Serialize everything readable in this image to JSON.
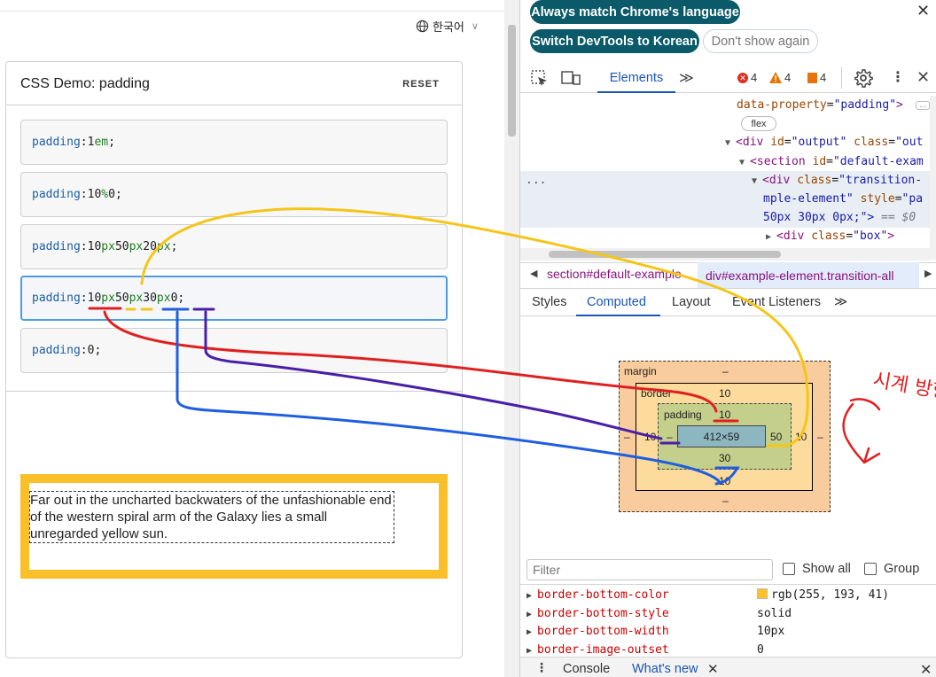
{
  "page": {
    "language": "한국어",
    "demo_title": "CSS Demo: padding",
    "reset_label": "RESET",
    "choices": [
      {
        "prop": "padding",
        "tokens": [
          {
            "n": "1",
            "u": "em"
          }
        ],
        "end": ";"
      },
      {
        "prop": "padding",
        "tokens": [
          {
            "n": "10",
            "u": "%"
          },
          {
            "n": "0",
            "u": ""
          }
        ],
        "end": ";"
      },
      {
        "prop": "padding",
        "tokens": [
          {
            "n": "10",
            "u": "px"
          },
          {
            "n": "50",
            "u": "px"
          },
          {
            "n": "20",
            "u": "px"
          }
        ],
        "end": ";"
      },
      {
        "prop": "padding",
        "tokens": [
          {
            "n": "10",
            "u": "px"
          },
          {
            "n": "50",
            "u": "px"
          },
          {
            "n": "30",
            "u": "px"
          },
          {
            "n": "0",
            "u": ""
          }
        ],
        "end": ";"
      },
      {
        "prop": "padding",
        "tokens": [
          {
            "n": "0",
            "u": ""
          }
        ],
        "end": ";"
      }
    ],
    "selected_choice": 3,
    "example_text": "Far out in the uncharted backwaters of the unfashionable end of the western spiral arm of the Galaxy lies a small unregarded yellow sun."
  },
  "devtools": {
    "banner": {
      "match_language": "Always match Chrome's language",
      "switch_language": "Switch DevTools to Korean",
      "dont_show": "Don't show again"
    },
    "tabs": {
      "elements": "Elements",
      "more": "≫"
    },
    "counts": {
      "errors": "4",
      "warnings": "4",
      "issues": "4"
    },
    "dom": {
      "line1": {
        "attr": "data-property",
        "val": "\"padding\"",
        "tail": ">"
      },
      "flex_badge": "flex",
      "line2": {
        "tag": "<div",
        "a1": "id",
        "v1": "\"output\"",
        "a2": "class",
        "v2": "\"out"
      },
      "line3": {
        "tag": "<section",
        "a1": "id",
        "v1": "\"default-exam"
      },
      "line4": {
        "tag": "<div",
        "a1": "class",
        "v1": "\"transition-"
      },
      "line5": {
        "a1": "mple-element\"",
        "a2": "style",
        "v2": "\"pa"
      },
      "line6": {
        "v": "50px 30px 0px;\">",
        "eq": " == $0"
      },
      "line7": {
        "tag": "<div",
        "a1": "class",
        "v1": "\"box\"",
        "tail": ">"
      },
      "ellipsis": "..."
    },
    "breadcrumbs": [
      "section#default-example",
      "div#example-element.transition-all"
    ],
    "subtabs": [
      "Styles",
      "Computed",
      "Layout",
      "Event Listeners",
      "≫"
    ],
    "active_subtab": "Computed",
    "box_model": {
      "margin_label": "margin",
      "margin_top": "–",
      "margin_bottom": "–",
      "margin_left": "–",
      "margin_right": "–",
      "border_label": "border",
      "border_top": "10",
      "border_bottom": "10",
      "border_left": "10",
      "border_right": "10",
      "padding_label": "padding",
      "padding_top": "10",
      "padding_bottom": "30",
      "padding_left": "–",
      "padding_right": "50",
      "content": "412×59"
    },
    "filter": {
      "placeholder": "Filter",
      "show_all": "Show all",
      "group": "Group"
    },
    "computed": [
      {
        "name": "border-bottom-color",
        "value": "rgb(255, 193, 41)",
        "swatch": "#ffc129"
      },
      {
        "name": "border-bottom-style",
        "value": "solid"
      },
      {
        "name": "border-bottom-width",
        "value": "10px"
      },
      {
        "name": "border-image-outset",
        "value": "0"
      }
    ],
    "drawer": {
      "console": "Console",
      "whats_new": "What's new"
    }
  },
  "annotations": {
    "handwriting": "시계 방향",
    "colors": {
      "top": "#e02020",
      "right": "#f5c518",
      "bottom": "#1f5ee0",
      "left": "#4a1fa8"
    }
  }
}
